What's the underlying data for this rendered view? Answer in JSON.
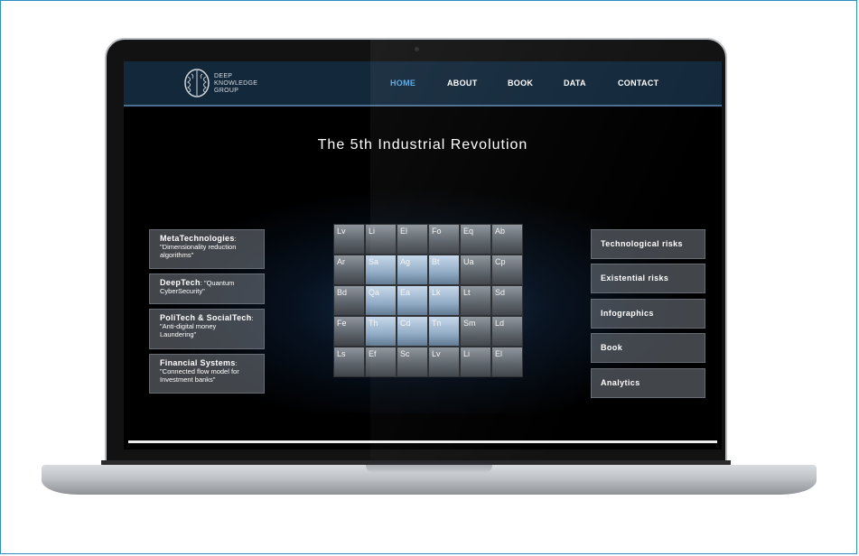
{
  "brand": {
    "logo_line1": "DEEP",
    "logo_line2": "KNOWLEDGE",
    "logo_line3": "GROUP"
  },
  "nav": {
    "items": [
      {
        "label": "HOME",
        "active": true
      },
      {
        "label": "ABOUT",
        "active": false
      },
      {
        "label": "BOOK",
        "active": false
      },
      {
        "label": "DATA",
        "active": false
      },
      {
        "label": "CONTACT",
        "active": false
      }
    ]
  },
  "hero": {
    "title": "The 5th Industrial Revolution"
  },
  "left_cards": [
    {
      "title": "MetaTechnologies",
      "body": ": \"Dimensionality reduction algorithms\""
    },
    {
      "title": "DeepTech",
      "body": ": \"Quantum CyberSecurity\""
    },
    {
      "title": "PoliTech & SocialTech",
      "body": ": \"Anti-digital money Laundering\""
    },
    {
      "title": "Financial Systems",
      "body": ": \"Connected flow model for Investment banks\""
    }
  ],
  "right_cards": [
    {
      "label": "Technological risks"
    },
    {
      "label": "Existential risks"
    },
    {
      "label": "Infographics"
    },
    {
      "label": "Book"
    },
    {
      "label": "Analytics"
    }
  ],
  "cube_tiles": [
    "Lv",
    "Li",
    "El",
    "Fo",
    "Eq",
    "Ab",
    "Ar",
    "Sa",
    "Ag",
    "Bt",
    "Ua",
    "Cp",
    "Bd",
    "Qa",
    "Ea",
    "Lk",
    "Lt",
    "Sd",
    "Fe",
    "Th",
    "Cd",
    "Tn",
    "Sm",
    "Ld",
    "Ls",
    "Ef",
    "Sc"
  ],
  "colors": {
    "accent": "#57a8e6",
    "nav_bg": "#13283b"
  }
}
